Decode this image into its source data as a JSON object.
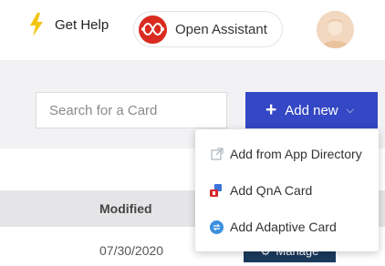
{
  "header": {
    "help_label": "Get Help",
    "assistant_label": "Open Assistant"
  },
  "search": {
    "placeholder": "Search for a Card"
  },
  "add_new": {
    "label": "Add new",
    "plus": "+",
    "chevron": "⌵"
  },
  "dropdown": {
    "items": [
      {
        "label": "Add from App Directory",
        "icon": "external-link-icon"
      },
      {
        "label": "Add QnA Card",
        "icon": "qna-card-icon"
      },
      {
        "label": "Add Adaptive Card",
        "icon": "adaptive-card-icon"
      }
    ]
  },
  "table": {
    "columns": {
      "modified": "Modified"
    },
    "rows": [
      {
        "modified": "07/30/2020",
        "action_label": "Manage"
      }
    ]
  },
  "colors": {
    "primary": "#3447c4",
    "manage_button": "#1b3a5e",
    "help_bolt": "#f3c511",
    "assistant_logo": "#d92b1f"
  }
}
